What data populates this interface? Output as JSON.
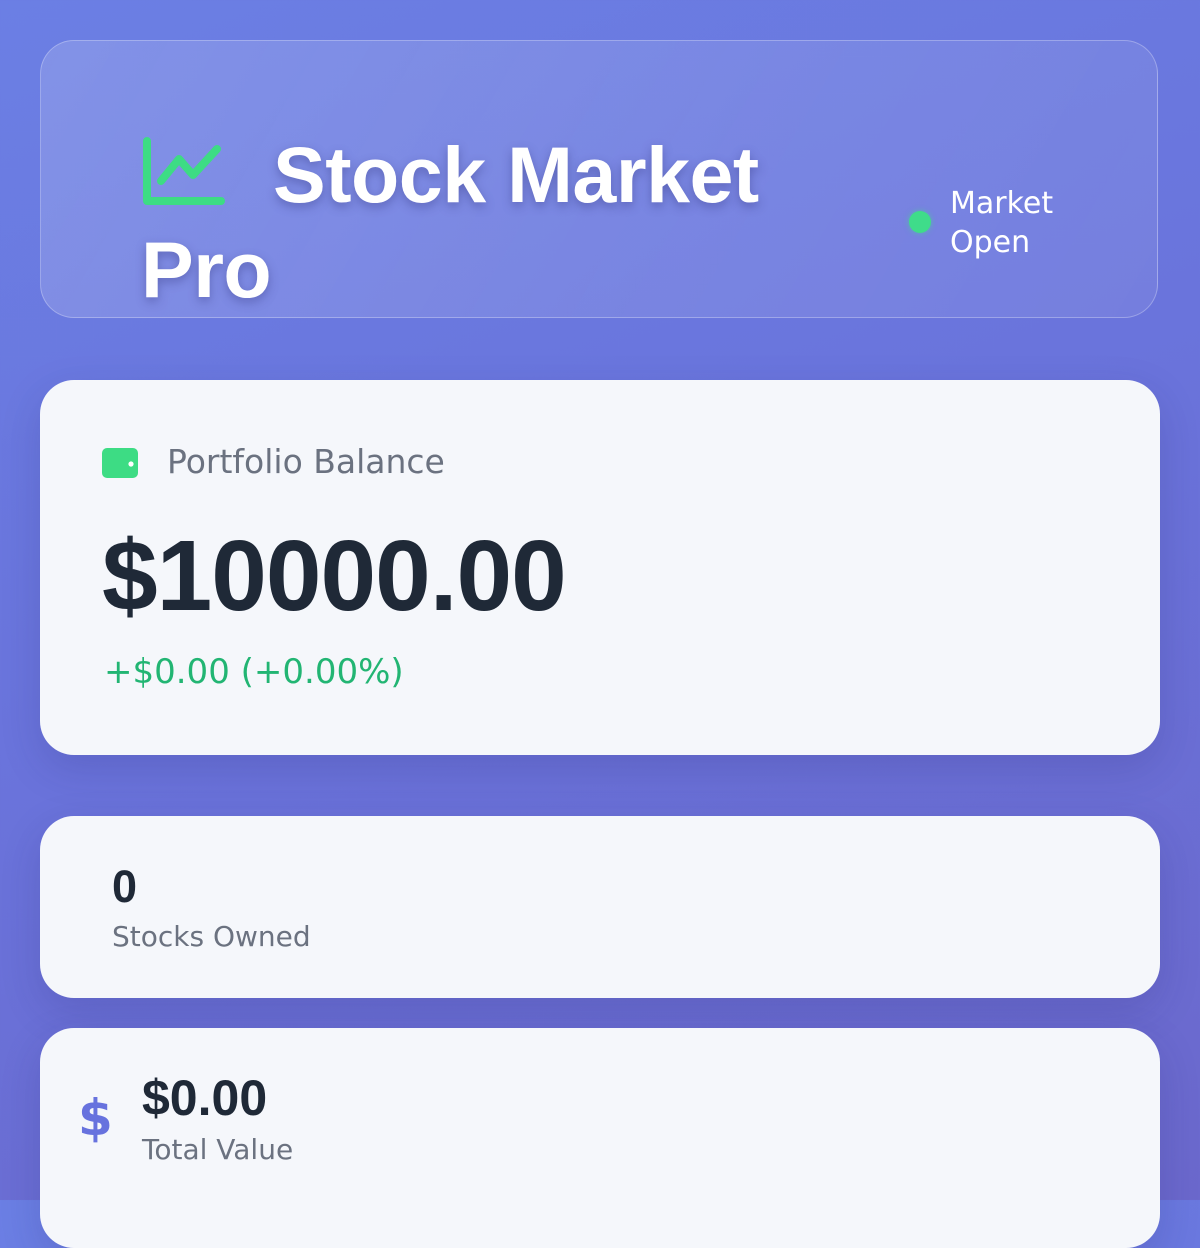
{
  "header": {
    "title": "Stock Market Pro",
    "title_icon": "chart-line-icon",
    "market_status": "Market Open",
    "status_color": "#3fdc8a"
  },
  "balance": {
    "icon": "wallet-icon",
    "label": "Portfolio Balance",
    "value": "$10000.00",
    "change": "+$0.00 (+0.00%)",
    "change_color": "#22b573"
  },
  "stocks_owned": {
    "value": "0",
    "label": "Stocks Owned"
  },
  "total_value": {
    "icon": "dollar-icon",
    "icon_glyph": "$",
    "value": "$0.00",
    "label": "Total Value",
    "icon_color": "#6772de"
  }
}
